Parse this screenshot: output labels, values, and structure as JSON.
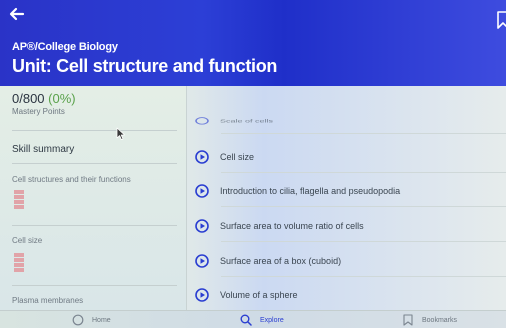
{
  "header": {
    "back_icon": "arrow-left-icon",
    "bookmark_icon": "bookmark-icon",
    "course": "AP®/College Biology",
    "unit_title": "Unit: Cell structure and function",
    "color": "#2c3fd6"
  },
  "sidebar": {
    "mastery_count": "0/800",
    "mastery_percent": "(0%)",
    "mastery_label": "Mastery Points",
    "skill_summary": "Skill summary",
    "lessons": [
      {
        "label": "Cell structures and their functions"
      },
      {
        "label": "Cell size"
      },
      {
        "label": "Plasma membranes"
      }
    ]
  },
  "main": {
    "partial_item": "Scale of cells",
    "items": [
      {
        "label": "Cell size",
        "icon": "play-circle-icon"
      },
      {
        "label": "Introduction to cilia, flagella and pseudopodia",
        "icon": "play-circle-icon"
      },
      {
        "label": "Surface area to volume ratio of cells",
        "icon": "play-circle-icon"
      },
      {
        "label": "Surface area of a box (cuboid)",
        "icon": "play-circle-icon"
      },
      {
        "label": "Volume of a sphere",
        "icon": "play-circle-icon"
      }
    ]
  },
  "bottom_nav": {
    "items": [
      {
        "label": "Home",
        "icon": "home-icon",
        "active": false
      },
      {
        "label": "Explore",
        "icon": "search-icon",
        "active": true
      },
      {
        "label": "Bookmarks",
        "icon": "bookmark-icon",
        "active": false
      }
    ]
  },
  "colors": {
    "accent": "#2a3ed1",
    "mastery_green": "#5aa24b",
    "progress_pink": "#e1a3a8"
  }
}
